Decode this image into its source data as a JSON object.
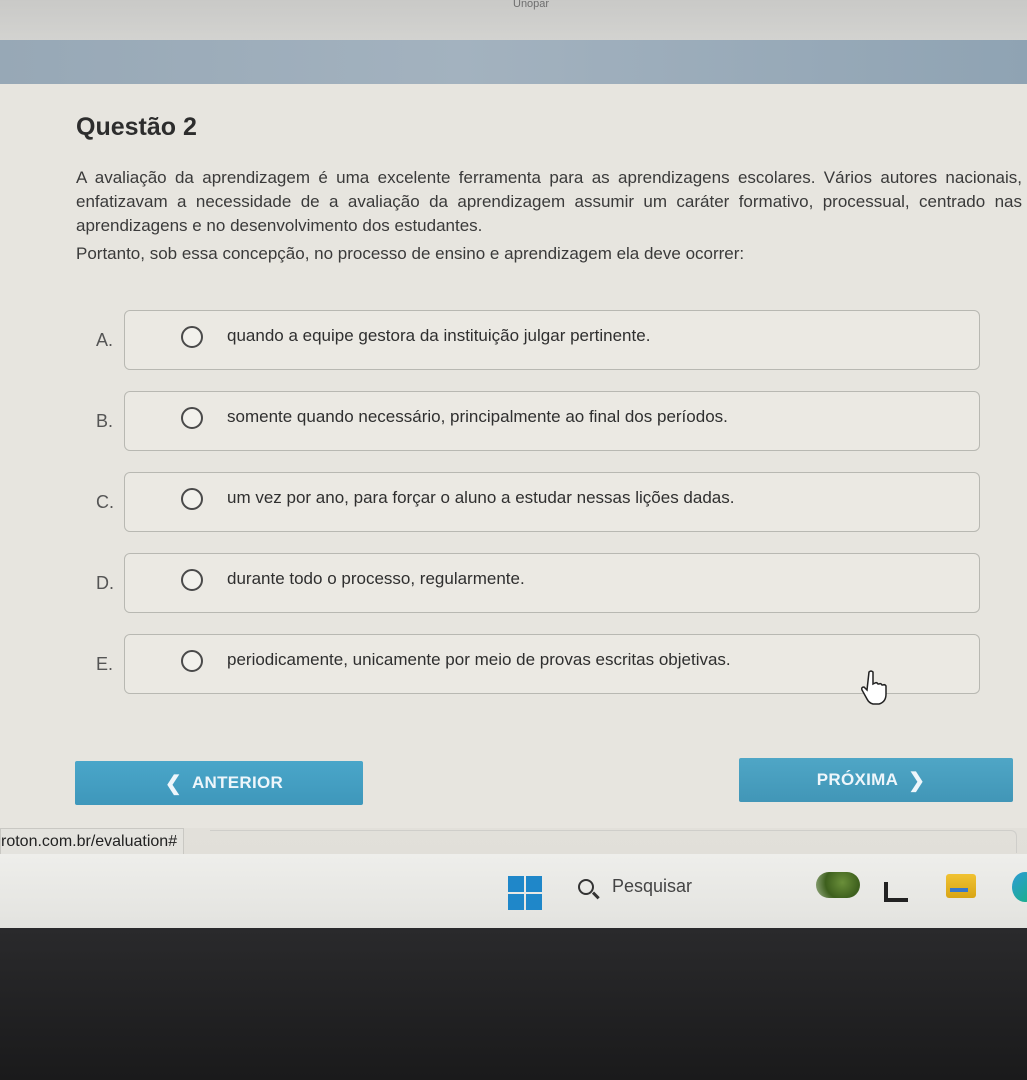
{
  "window": {
    "top_label": "Unopar"
  },
  "question": {
    "title": "Questão 2",
    "paragraphs": [
      "A avaliação da aprendizagem é uma excelente ferramenta para as aprendizagens escolares. Vários autores nacionais, enfatizavam a necessidade de a avaliação da aprendizagem assumir um caráter formativo, processual, centrado nas aprendizagens e no desenvolvimento dos estudantes."
    ],
    "prompt": "Portanto, sob essa concepção, no processo de ensino e aprendizagem ela deve ocorrer:"
  },
  "options": [
    {
      "letter": "A.",
      "text": "quando a equipe gestora da instituição julgar pertinente."
    },
    {
      "letter": "B.",
      "text": "somente quando necessário, principalmente ao final dos períodos."
    },
    {
      "letter": "C.",
      "text": "um vez por ano, para forçar o aluno a estudar nessas lições dadas."
    },
    {
      "letter": "D.",
      "text": "durante todo o processo, regularmente."
    },
    {
      "letter": "E.",
      "text": "periodicamente, unicamente por meio de provas escritas objetivas."
    }
  ],
  "nav": {
    "prev_label": "ANTERIOR",
    "next_label": "PRÓXIMA",
    "prev_icon": "chevron-left-icon",
    "next_icon": "chevron-right-icon",
    "button_color": "#4aa3c6"
  },
  "status_bar": {
    "url": "roton.com.br/evaluation#"
  },
  "taskbar": {
    "search_placeholder": "Pesquisar",
    "icons": [
      "windows-start-icon",
      "search-icon",
      "widgets-icon",
      "file-explorer-icon",
      "folder-icon",
      "edge-icon"
    ]
  }
}
